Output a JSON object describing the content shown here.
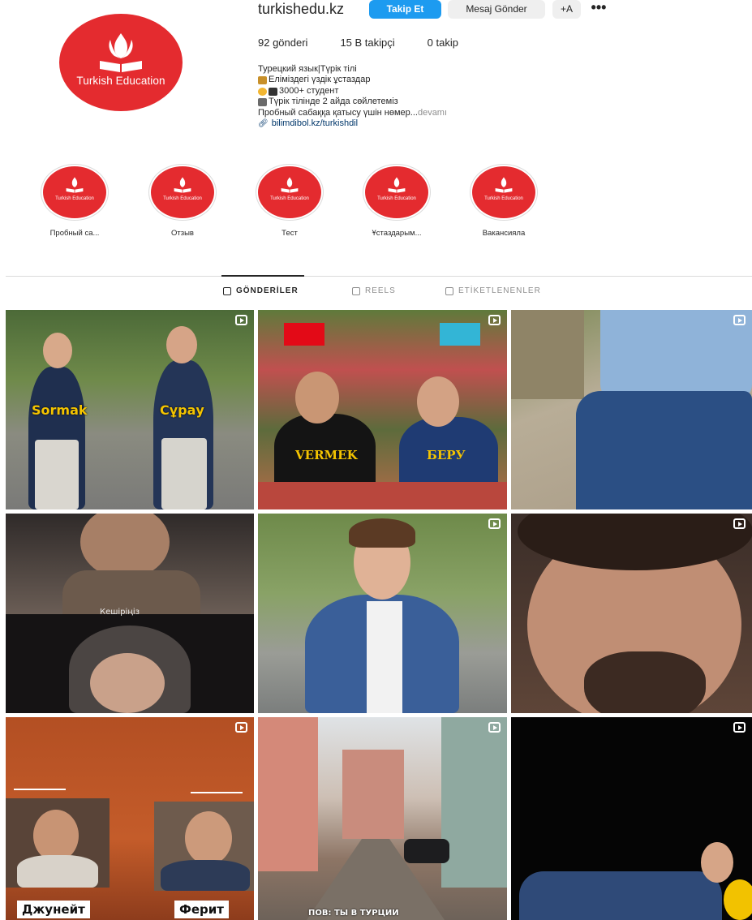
{
  "profile": {
    "username": "turkishedu.kz",
    "avatar_brand": "Turkish Education",
    "follow_label": "Takip Et",
    "message_label": "Mesaj Gönder",
    "add_friend_label": "+A",
    "more_label": "•••"
  },
  "stats": {
    "posts": "92 gönderi",
    "followers": "15 B takipçi",
    "following": "0 takip"
  },
  "bio": {
    "line1": "Турецкий язык|Түрік тілі",
    "line2": "Еліміздегі үздік ұстаздар",
    "line3": "3000+ студент",
    "line4": "Түрік тілінде 2 айда сөйлетеміз",
    "line5": "Пробный сабаққа қатысу үшін нөмер...",
    "more": " devamı",
    "link": "bilimdibol.kz/turkishdil"
  },
  "highlights": [
    {
      "label": "Пробный са...",
      "brand": "Turkish Education"
    },
    {
      "label": "Отзыв",
      "brand": "Turkish Education"
    },
    {
      "label": "Тест",
      "brand": "Turkish Education"
    },
    {
      "label": "Ұстаздарым...",
      "brand": "Turkish Education"
    },
    {
      "label": "Вакансиялa",
      "brand": "Turkish Education"
    }
  ],
  "tabs": [
    {
      "label": "GÖNDERİLER",
      "icon": "grid-icon",
      "active": true
    },
    {
      "label": "REELS",
      "icon": "reels-icon",
      "active": false
    },
    {
      "label": "ETİKETLENENLER",
      "icon": "tagged-icon",
      "active": false
    }
  ],
  "posts": [
    {
      "caption_left": "Sormak",
      "caption_right": "Сұрау"
    },
    {
      "caption_left": "VERMEK",
      "caption_right": "БЕРУ"
    },
    {},
    {
      "caption_center": "Кешіріңіз"
    },
    {},
    {},
    {
      "caption_left": "Джунейт",
      "caption_right": "Ферит"
    },
    {
      "caption_center": "ПОВ: ТЫ В ТУРЦИИ"
    },
    {}
  ],
  "colors": {
    "brand_red": "#e42b2f",
    "follow_blue": "#1d9bf0",
    "secondary_button": "#efefef",
    "muted_text": "#8e8e8e",
    "link_text": "#00376b"
  }
}
